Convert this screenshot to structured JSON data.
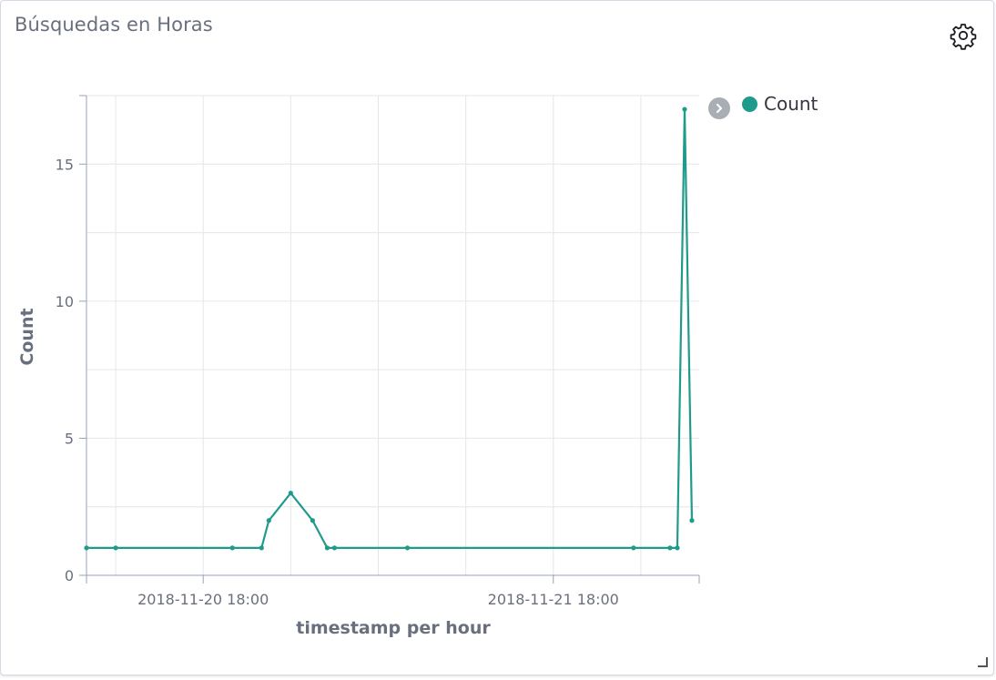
{
  "panel": {
    "title": "Búsquedas en Horas",
    "options_icon": "gear-icon"
  },
  "legend": {
    "toggle_icon": "chevron-right-icon",
    "items": [
      {
        "label": "Count",
        "color": "#1f9b8c"
      }
    ]
  },
  "chart_data": {
    "type": "line",
    "series": [
      {
        "name": "Count",
        "color": "#1f9b8c",
        "points": [
          {
            "x": "2018-11-20 10:00",
            "y": 1
          },
          {
            "x": "2018-11-20 12:00",
            "y": 1
          },
          {
            "x": "2018-11-20 20:00",
            "y": 1
          },
          {
            "x": "2018-11-20 22:00",
            "y": 1
          },
          {
            "x": "2018-11-20 22:30",
            "y": 2
          },
          {
            "x": "2018-11-21 00:00",
            "y": 3
          },
          {
            "x": "2018-11-21 01:30",
            "y": 2
          },
          {
            "x": "2018-11-21 02:30",
            "y": 1
          },
          {
            "x": "2018-11-21 03:00",
            "y": 1
          },
          {
            "x": "2018-11-21 08:00",
            "y": 1
          },
          {
            "x": "2018-11-21 23:30",
            "y": 1
          },
          {
            "x": "2018-11-22 02:00",
            "y": 1
          },
          {
            "x": "2018-11-22 02:30",
            "y": 1
          },
          {
            "x": "2018-11-22 03:00",
            "y": 17
          },
          {
            "x": "2018-11-22 03:30",
            "y": 2
          }
        ]
      }
    ],
    "xlabel": "timestamp per hour",
    "ylabel": "Count",
    "xlim": [
      "2018-11-20 10:00",
      "2018-11-22 04:00"
    ],
    "ylim": [
      0,
      17.5
    ],
    "x_tick_labels": [
      "2018-11-20 18:00",
      "2018-11-21 18:00"
    ],
    "y_ticks": [
      0,
      5,
      10,
      15
    ],
    "grid": true,
    "legend_position": "right"
  }
}
